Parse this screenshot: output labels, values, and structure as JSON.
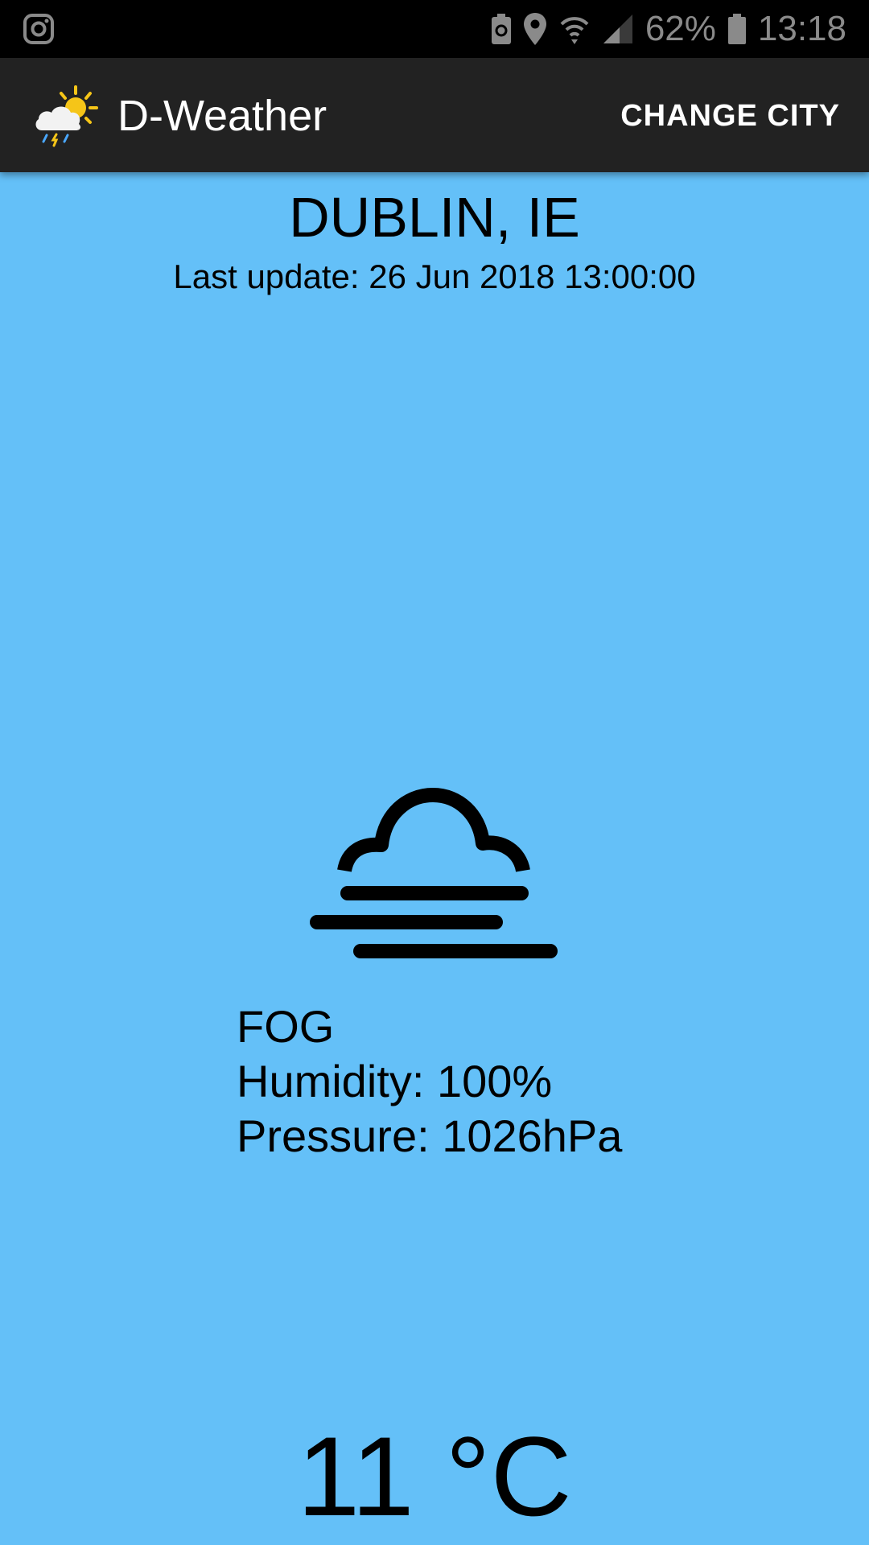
{
  "status_bar": {
    "battery": "62%",
    "time": "13:18",
    "icons": [
      "instagram-icon",
      "battery-saver-icon",
      "location-icon",
      "wifi-icon",
      "signal-icon",
      "battery-icon"
    ]
  },
  "app_bar": {
    "logo_icon": "weather-logo-icon",
    "title": "D-Weather",
    "change_city_label": "CHANGE CITY"
  },
  "weather": {
    "city": "DUBLIN, IE",
    "last_update": "Last update: 26 Jun 2018 13:00:00",
    "condition_icon": "fog-icon",
    "condition": "FOG",
    "humidity": "Humidity: 100%",
    "pressure": "Pressure: 1026hPa",
    "temperature": "11 °C"
  },
  "colors": {
    "background": "#64c0f8",
    "app_bar": "#222222",
    "status_bar": "#000000"
  }
}
